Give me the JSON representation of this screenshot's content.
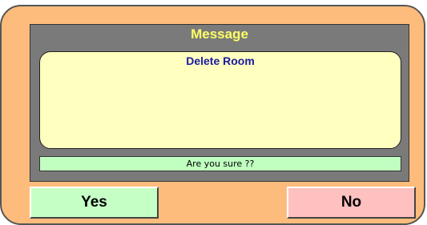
{
  "dialog": {
    "title": "Message",
    "heading": "Delete Room",
    "body": "",
    "confirm_text": "Are you sure ??",
    "yes_label": "Yes",
    "no_label": "No"
  },
  "colors": {
    "frame": "#fdbc7c",
    "panel": "#7a7a7a",
    "title_text": "#ffff66",
    "message_box": "#ffffc0",
    "heading_text": "#1a1aa0",
    "confirm_bar": "#c0ffc0",
    "yes_button": "#c6ffc6",
    "no_button": "#ffc0c0"
  }
}
